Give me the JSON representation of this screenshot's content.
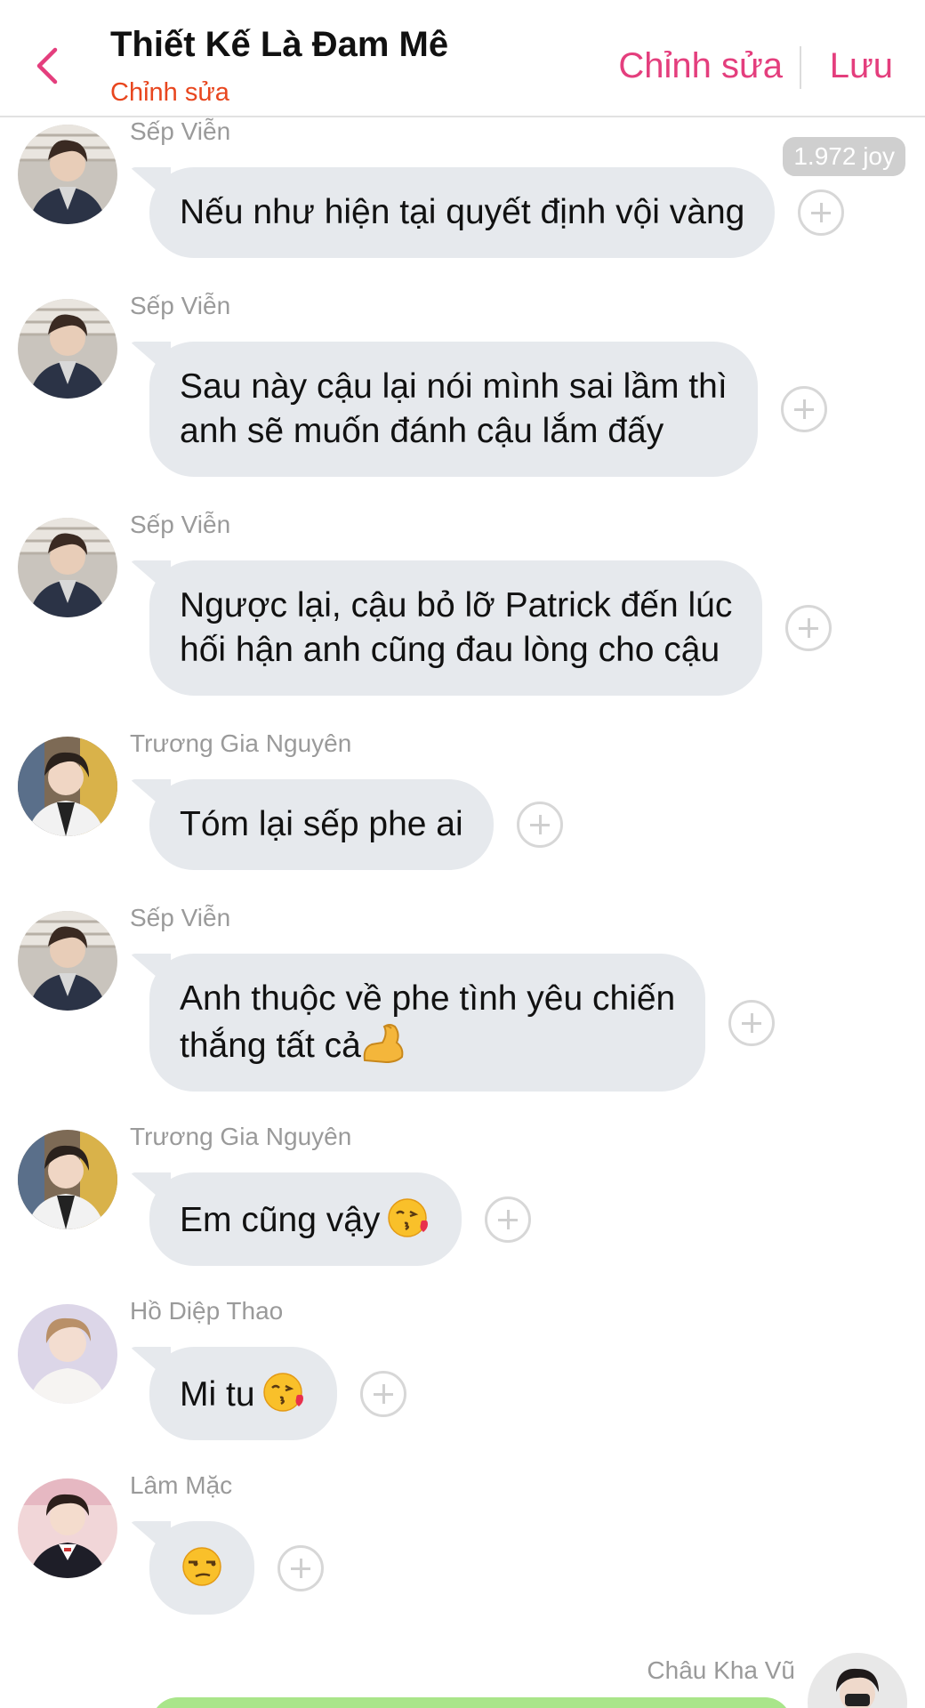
{
  "header": {
    "title": "Thiết Kế Là Đam Mê",
    "subtitle": "Chỉnh sửa",
    "edit_label": "Chỉnh sửa",
    "save_label": "Lưu",
    "back_icon": "chevron-left-icon",
    "accent_color": "#e43e7d"
  },
  "joy_badge": "1.972 joy",
  "messages": [
    {
      "sender": "Sếp Viễn",
      "text": "Nếu như hiện tại quyết định vội vàng"
    },
    {
      "sender": "Sếp Viễn",
      "text": "Sau này cậu lại nói mình sai lầm thì\nanh sẽ muốn đánh cậu lắm đấy"
    },
    {
      "sender": "Sếp Viễn",
      "text": "Ngược lại, cậu bỏ lỡ Patrick đến lúc\nhối hận anh cũng đau lòng cho cậu"
    },
    {
      "sender": "Trương Gia Nguyên",
      "text": "Tóm lại sếp phe ai"
    },
    {
      "sender": "Sếp Viễn",
      "text": "Anh thuộc về phe tình yêu chiến\nthắng tất cả",
      "emoji": "flexed-biceps-emoji"
    },
    {
      "sender": "Trương Gia Nguyên",
      "text": "Em cũng vậy",
      "emoji": "face-blowing-kiss-emoji"
    },
    {
      "sender": "Hồ Diệp Thao",
      "text": "Mi tu",
      "emoji": "face-blowing-kiss-emoji"
    },
    {
      "sender": "Lâm Mặc",
      "text": "",
      "emoji": "unamused-face-emoji"
    }
  ],
  "own_message": {
    "sender": "Châu Kha Vũ",
    "bubble_color": "#a9e58a"
  }
}
